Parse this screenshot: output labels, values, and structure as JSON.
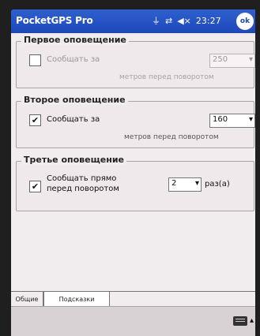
{
  "titlebar": {
    "app_title": "PocketGPS Pro",
    "time": "23:27",
    "ok_label": "ok"
  },
  "group1": {
    "title": "Первое оповещение",
    "checkbox_checked": false,
    "label": "Сообщать за",
    "select_value": "250",
    "meters_text": "метров перед поворотом"
  },
  "group2": {
    "title": "Второе оповещение",
    "checkbox_checked": true,
    "label": "Сообщать за",
    "select_value": "160",
    "meters_text": "метров перед поворотом"
  },
  "group3": {
    "title": "Третье оповещение",
    "checkbox_checked": true,
    "label_line1": "Сообщать прямо",
    "label_line2": "перед поворотом",
    "select_value": "2",
    "unit": "раз(а)"
  },
  "tabs": [
    {
      "label": "Общие"
    },
    {
      "label": "Подсказки"
    }
  ],
  "status_icons": [
    "signal-icon",
    "sync-icon",
    "volume-icon"
  ]
}
